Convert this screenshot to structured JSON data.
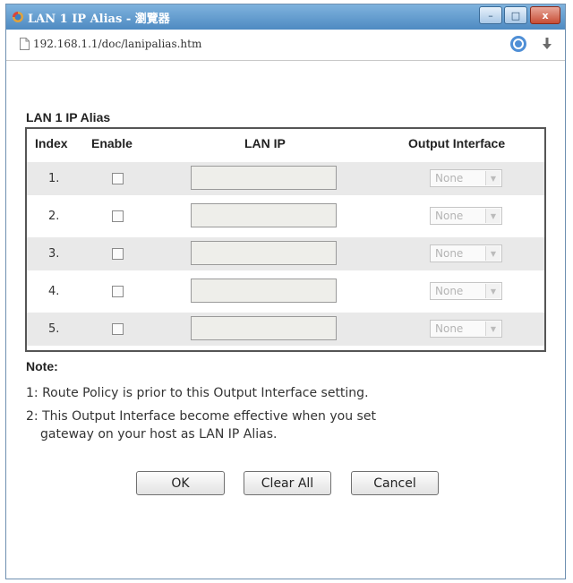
{
  "window": {
    "title": "LAN 1 IP Alias - 瀏覽器",
    "controls": {
      "minimize": "–",
      "maximize": "□",
      "close": "x"
    }
  },
  "address_bar": {
    "url": "192.168.1.1/doc/lanipalias.htm"
  },
  "section": {
    "title": "LAN 1 IP Alias"
  },
  "table": {
    "headers": {
      "index": "Index",
      "enable": "Enable",
      "lan_ip": "LAN IP",
      "output_interface": "Output Interface"
    },
    "rows": [
      {
        "index": "1.",
        "enabled": false,
        "lan_ip": "",
        "output_interface": "None"
      },
      {
        "index": "2.",
        "enabled": false,
        "lan_ip": "",
        "output_interface": "None"
      },
      {
        "index": "3.",
        "enabled": false,
        "lan_ip": "",
        "output_interface": "None"
      },
      {
        "index": "4.",
        "enabled": false,
        "lan_ip": "",
        "output_interface": "None"
      },
      {
        "index": "5.",
        "enabled": false,
        "lan_ip": "",
        "output_interface": "None"
      }
    ]
  },
  "notes": {
    "title": "Note:",
    "lines": [
      "1: Route Policy is prior to this Output Interface setting.",
      "2: This Output Interface become effective when you set",
      "gateway on your host as LAN IP Alias."
    ]
  },
  "buttons": {
    "ok": "OK",
    "clear_all": "Clear All",
    "cancel": "Cancel"
  },
  "colors": {
    "title_bar": "#4e8ac2",
    "row_shade": "#e9e9e9",
    "table_border": "#555555"
  }
}
